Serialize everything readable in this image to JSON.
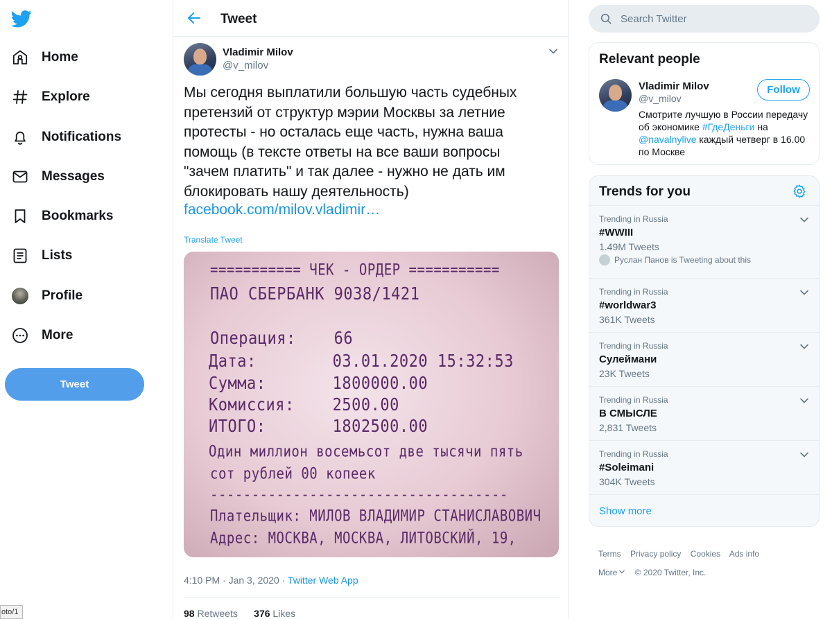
{
  "nav": {
    "items": [
      {
        "label": "Home",
        "icon": "home-icon"
      },
      {
        "label": "Explore",
        "icon": "hashtag-icon"
      },
      {
        "label": "Notifications",
        "icon": "bell-icon"
      },
      {
        "label": "Messages",
        "icon": "envelope-icon"
      },
      {
        "label": "Bookmarks",
        "icon": "bookmark-icon"
      },
      {
        "label": "Lists",
        "icon": "list-icon"
      },
      {
        "label": "Profile",
        "icon": "profile-avatar-icon"
      },
      {
        "label": "More",
        "icon": "more-circle-icon"
      }
    ],
    "tweet_button": "Tweet"
  },
  "header": {
    "title": "Tweet"
  },
  "tweet": {
    "author_name": "Vladimir Milov",
    "author_handle": "@v_milov",
    "text": "Мы сегодня выплатили большую часть судебных\nпретензий от структур мэрии Москвы за летние\nпротесты - но осталась еще часть, нужна ваша\nпомощь (в тексте ответы на все ваши вопросы\n\"зачем платить\" и так далее - нужно не дать им\nблокировать нашу деятельность)",
    "link": "facebook.com/milov.vladimir…",
    "translate": "Translate Tweet",
    "time": "4:10 PM · Jan 3, 2020 · ",
    "app": "Twitter Web App",
    "retweets": "98",
    "retweets_label": "Retweets",
    "likes": "376",
    "likes_label": "Likes"
  },
  "receipt": {
    "lines": [
      "=========== ЧЕК - ОРДЕР ===========",
      "ПАО СБЕРБАНК 9038/1421",
      "Операция:    66",
      "Дата:        03.01.2020 15:32:53",
      "Сумма:       1800000.00",
      "Комиссия:    2500.00",
      "ИТОГО:       1802500.00",
      "Один миллион восемьсот две тысячи пять",
      "сот рублей 00 копеек",
      "------------------------------------",
      "Плательщик: МИЛОВ ВЛАДИМИР СТАНИСЛАВОВИЧ",
      "Адрес: МОСКВА, МОСКВА, ЛИТОВСКИЙ, 19,"
    ]
  },
  "search": {
    "placeholder": "Search Twitter"
  },
  "relevant": {
    "title": "Relevant people",
    "name": "Vladimir Milov",
    "handle": "@v_milov",
    "follow": "Follow",
    "bio_1": "Смотрите лучшую в России передачу об экономике ",
    "bio_tag1": "#ГдеДеньги",
    "bio_2": " на ",
    "bio_tag2": "@navalnylive",
    "bio_3": " каждый четверг в 16.00 по Москве"
  },
  "trends": {
    "title": "Trends for you",
    "items": [
      {
        "context": "Trending in Russia",
        "name": "#WWIII",
        "count": "1.49M Tweets",
        "who": "Руслан Панов is Tweeting about this"
      },
      {
        "context": "Trending in Russia",
        "name": "#worldwar3",
        "count": "361K Tweets"
      },
      {
        "context": "Trending in Russia",
        "name": "Сулеймани",
        "count": "23K Tweets"
      },
      {
        "context": "Trending in Russia",
        "name": "В СМЫСЛЕ",
        "count": "2,831 Tweets"
      },
      {
        "context": "Trending in Russia",
        "name": "#Soleimani",
        "count": "304K Tweets"
      }
    ],
    "show_more": "Show more"
  },
  "footer": {
    "links": [
      "Terms",
      "Privacy policy",
      "Cookies",
      "Ads info"
    ],
    "more": "More",
    "copyright": "© 2020 Twitter, Inc."
  },
  "statusbar": {
    "text": "oto/1"
  },
  "colors": {
    "accent": "#1da1f2",
    "text": "#14171a",
    "muted": "#657786",
    "border": "#e6ecf0"
  }
}
